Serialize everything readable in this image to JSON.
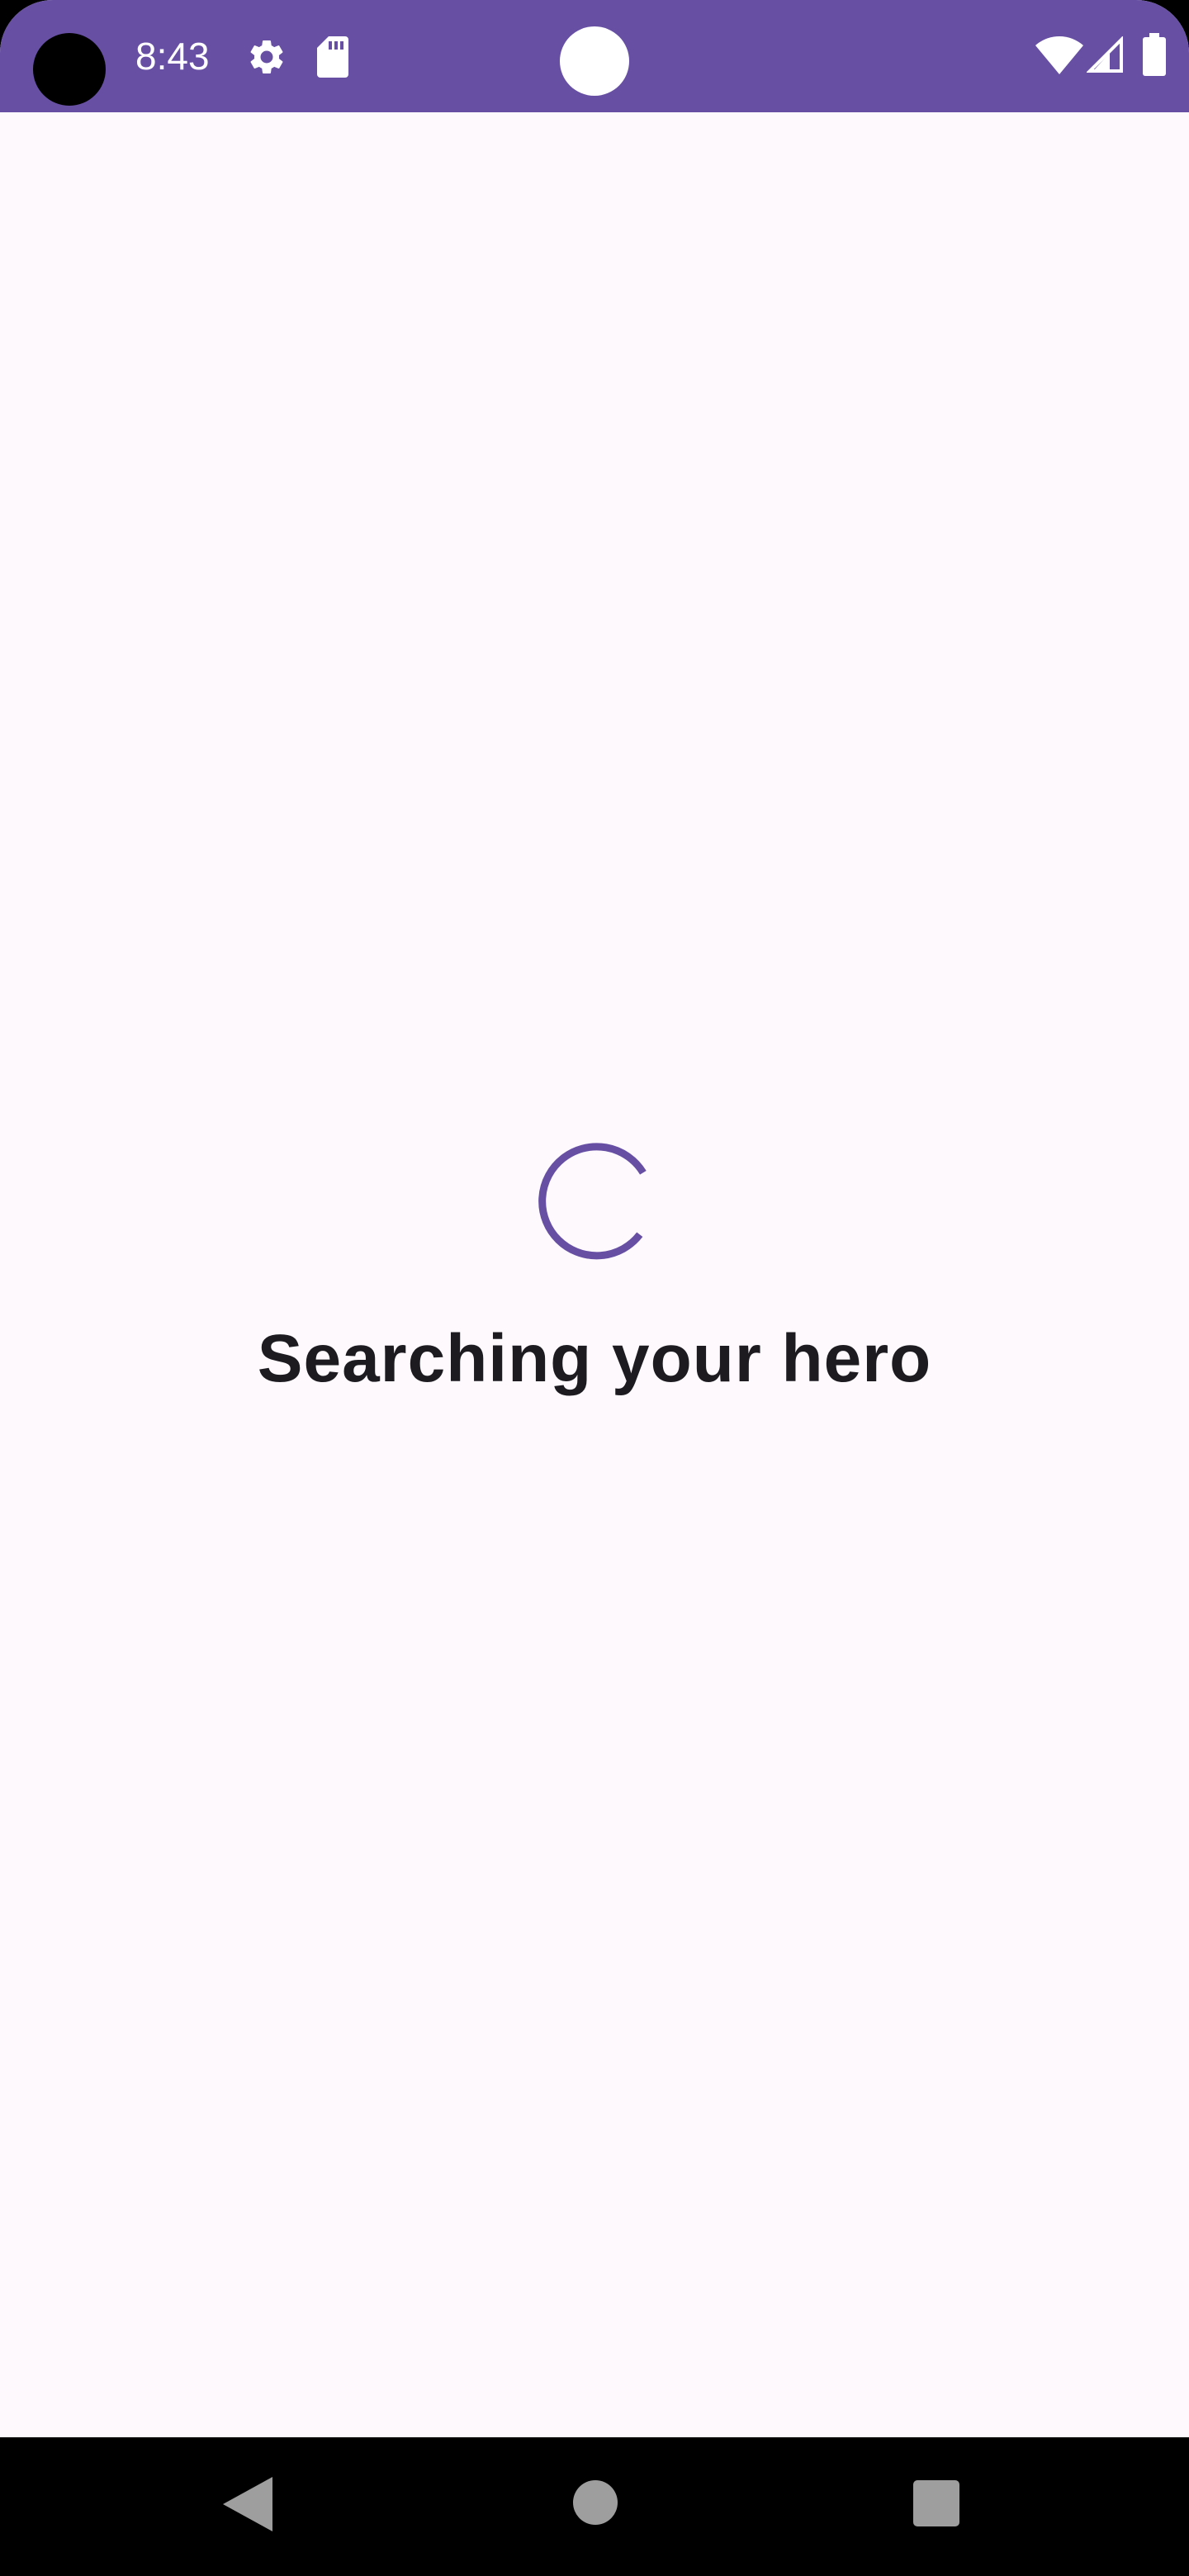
{
  "status_bar": {
    "time": "8:43",
    "background_color": "#6750a4",
    "icons": [
      "gear-icon",
      "sdcard-icon",
      "wifi-icon",
      "signal-icon",
      "battery-icon"
    ]
  },
  "main": {
    "loading_text": "Searching your hero",
    "spinner_color": "#6750a4",
    "background_color": "#fdf9fd"
  },
  "nav_bar": {
    "buttons": [
      "back",
      "home",
      "recents"
    ]
  }
}
